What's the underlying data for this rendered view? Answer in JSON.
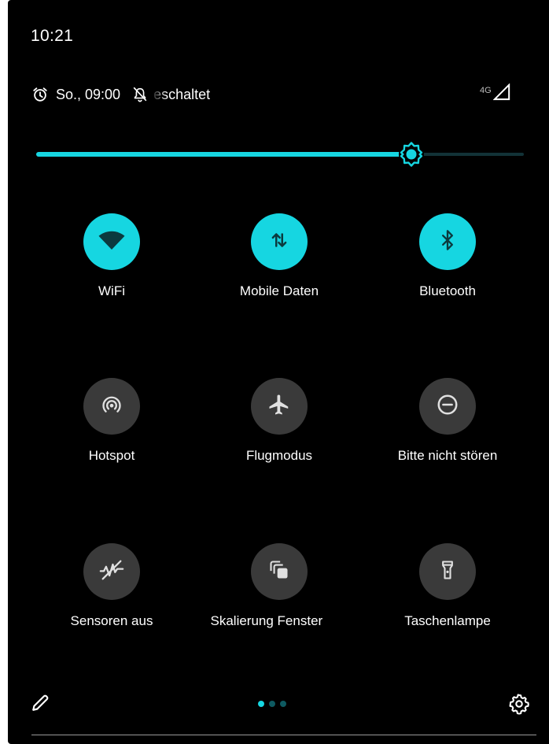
{
  "status_bar": {
    "time": "10:21",
    "alarm_icon": "alarm-clock-icon",
    "alarm_time": "So., 09:00",
    "dnd_icon": "bell-off-icon",
    "dnd_text": "eschaltet",
    "network_type": "4G",
    "signal_icon": "signal-strength-icon"
  },
  "brightness": {
    "level_percent": 77,
    "icon": "brightness-sun-icon"
  },
  "tiles": [
    {
      "label": "WiFi",
      "icon": "wifi-icon",
      "active": true
    },
    {
      "label": "Mobile Daten",
      "icon": "mobile-data-icon",
      "active": true
    },
    {
      "label": "Bluetooth",
      "icon": "bluetooth-icon",
      "active": true
    },
    {
      "label": "Hotspot",
      "icon": "hotspot-icon",
      "active": false
    },
    {
      "label": "Flugmodus",
      "icon": "airplane-icon",
      "active": false
    },
    {
      "label": "Bitte nicht stören",
      "icon": "do-not-disturb-icon",
      "active": false
    },
    {
      "label": "Sensoren aus",
      "icon": "sensors-off-icon",
      "active": false
    },
    {
      "label": "Skalierung Fenster",
      "icon": "window-scaling-icon",
      "active": false
    },
    {
      "label": "Taschenlampe",
      "icon": "flashlight-icon",
      "active": false
    }
  ],
  "footer": {
    "edit_icon": "pencil-icon",
    "page_count": 3,
    "current_page": 1,
    "settings_icon": "gear-icon"
  },
  "colors": {
    "accent": "#16d6e1",
    "tile_off": "#3a3a3a",
    "background": "#000000"
  }
}
